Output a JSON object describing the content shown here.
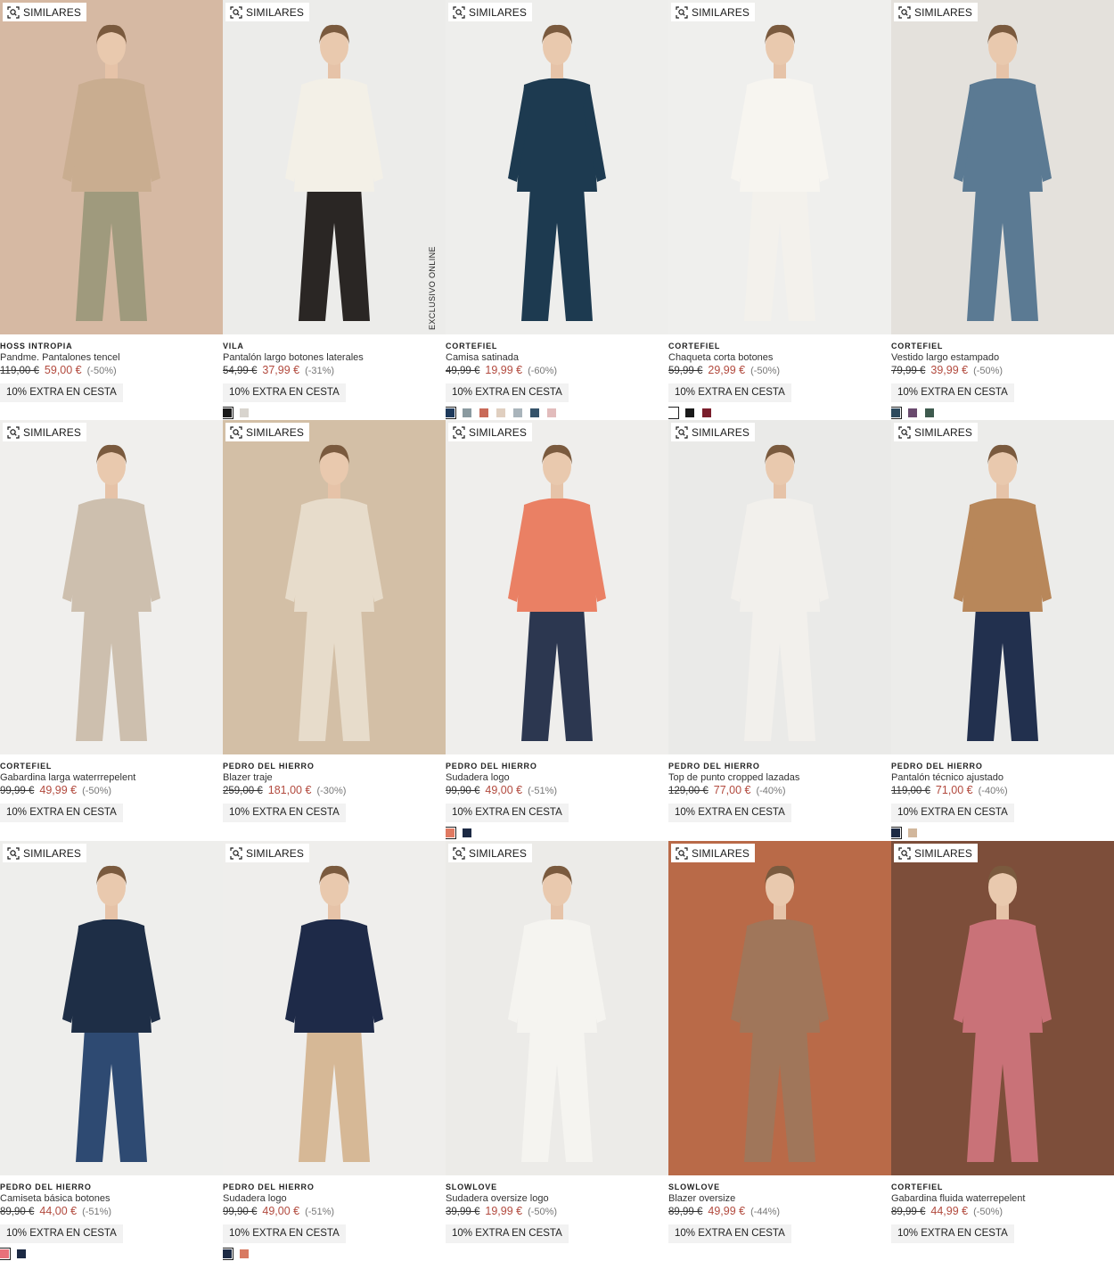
{
  "similar_label": "SIMILARES",
  "exclusive_label": "EXCLUSIVO ONLINE",
  "products": [
    {
      "brand": "HOSS INTROPIA",
      "name": "Pandme. Pantalones tencel",
      "old_price": "119,00 €",
      "price": "59,00 €",
      "discount": "(-50%)",
      "promo": "10% EXTRA EN CESTA",
      "swatches": [],
      "bg": "#d6b9a3",
      "figure": "#9f9a7d",
      "top": "#c9ad90"
    },
    {
      "brand": "VILA",
      "name": "Pantalón largo botones laterales",
      "old_price": "54,99 €",
      "price": "37,99 €",
      "discount": "(-31%)",
      "promo": "10% EXTRA EN CESTA",
      "swatches": [
        "#1a1a1a",
        "#d8d4ce"
      ],
      "bg": "#ececea",
      "figure": "#2a2624",
      "top": "#f3f0e7"
    },
    {
      "brand": "CORTEFIEL",
      "name": "Camisa satinada",
      "old_price": "49,99 €",
      "price": "19,99 €",
      "discount": "(-60%)",
      "promo": "10% EXTRA EN CESTA",
      "swatches": [
        "#1e3a5c",
        "#8a9aa0",
        "#c96a58",
        "#e0cfc0",
        "#a9b4bb",
        "#35536a",
        "#e2bcbc"
      ],
      "bg": "#eeeeec",
      "figure": "#1d3a50",
      "top": "#1d3a50"
    },
    {
      "brand": "CORTEFIEL",
      "name": "Chaqueta corta botones",
      "old_price": "59,99 €",
      "price": "29,99 €",
      "discount": "(-50%)",
      "promo": "10% EXTRA EN CESTA",
      "swatches": [
        "#ffffff",
        "#1a1a1a",
        "#7a1e2c"
      ],
      "bg": "#efefed",
      "figure": "#f3f1ec",
      "top": "#f7f5f0"
    },
    {
      "brand": "CORTEFIEL",
      "name": "Vestido largo estampado",
      "old_price": "79,99 €",
      "price": "39,99 €",
      "discount": "(-50%)",
      "promo": "10% EXTRA EN CESTA",
      "swatches": [
        "#2d4a5e",
        "#6a4a6e",
        "#3e5a4e"
      ],
      "bg": "#e4e1dc",
      "figure": "#5b7a93",
      "top": "#5b7a93"
    },
    {
      "brand": "CORTEFIEL",
      "name": "Gabardina larga waterrrepelent",
      "old_price": "99,99 €",
      "price": "49,99 €",
      "discount": "(-50%)",
      "promo": "10% EXTRA EN CESTA",
      "swatches": [],
      "bg": "#f0efed",
      "figure": "#cdbfae",
      "top": "#cdbfae"
    },
    {
      "brand": "PEDRO DEL HIERRO",
      "name": "Blazer traje",
      "old_price": "259,00 €",
      "price": "181,00 €",
      "discount": "(-30%)",
      "promo": "10% EXTRA EN CESTA",
      "swatches": [],
      "bg": "#d3bfa6",
      "figure": "#e7dccb",
      "top": "#e7dccb"
    },
    {
      "brand": "PEDRO DEL HIERRO",
      "name": "Sudadera logo",
      "old_price": "99,90 €",
      "price": "49,00 €",
      "discount": "(-51%)",
      "promo": "10% EXTRA EN CESTA",
      "swatches": [
        "#e07a62",
        "#1c2a44"
      ],
      "bg": "#efeeec",
      "figure": "#2c3750",
      "top": "#ea8064"
    },
    {
      "brand": "PEDRO DEL HIERRO",
      "name": "Top de punto cropped lazadas",
      "old_price": "129,00 €",
      "price": "77,00 €",
      "discount": "(-40%)",
      "promo": "10% EXTRA EN CESTA",
      "swatches": [],
      "bg": "#eaeae8",
      "figure": "#f2f0ec",
      "top": "#f2f0ec"
    },
    {
      "brand": "PEDRO DEL HIERRO",
      "name": "Pantalón técnico ajustado",
      "old_price": "119,00 €",
      "price": "71,00 €",
      "discount": "(-40%)",
      "promo": "10% EXTRA EN CESTA",
      "swatches": [
        "#1c2a44",
        "#d2b79c"
      ],
      "bg": "#ececea",
      "figure": "#22304e",
      "top": "#b8875a"
    },
    {
      "brand": "PEDRO DEL HIERRO",
      "name": "Camiseta básica botones",
      "old_price": "89,90 €",
      "price": "44,00 €",
      "discount": "(-51%)",
      "promo": "10% EXTRA EN CESTA",
      "swatches": [
        "#e8707a",
        "#1c2a44"
      ],
      "bg": "#eeeeec",
      "figure": "#2e4a72",
      "top": "#1e2e46"
    },
    {
      "brand": "PEDRO DEL HIERRO",
      "name": "Sudadera logo",
      "old_price": "99,90 €",
      "price": "49,00 €",
      "discount": "(-51%)",
      "promo": "10% EXTRA EN CESTA",
      "swatches": [
        "#1c2a44",
        "#d87a62"
      ],
      "bg": "#efeeec",
      "figure": "#d6b896",
      "top": "#1e2a48"
    },
    {
      "brand": "SLOWLOVE",
      "name": "Sudadera oversize logo",
      "old_price": "39,99 €",
      "price": "19,99 €",
      "discount": "(-50%)",
      "promo": "10% EXTRA EN CESTA",
      "swatches": [],
      "bg": "#ecebe8",
      "figure": "#f5f4f0",
      "top": "#f5f4f0"
    },
    {
      "brand": "SLOWLOVE",
      "name": "Blazer oversize",
      "old_price": "89,99 €",
      "price": "49,99 €",
      "discount": "(-44%)",
      "promo": "10% EXTRA EN CESTA",
      "swatches": [],
      "bg": "#b96a48",
      "figure": "#a0765a",
      "top": "#a0765a"
    },
    {
      "brand": "CORTEFIEL",
      "name": "Gabardina fluida waterrepelent",
      "old_price": "89,99 €",
      "price": "44,99 €",
      "discount": "(-50%)",
      "promo": "10% EXTRA EN CESTA",
      "swatches": [],
      "bg": "#7d4e3a",
      "figure": "#c97278",
      "top": "#c97278"
    }
  ]
}
